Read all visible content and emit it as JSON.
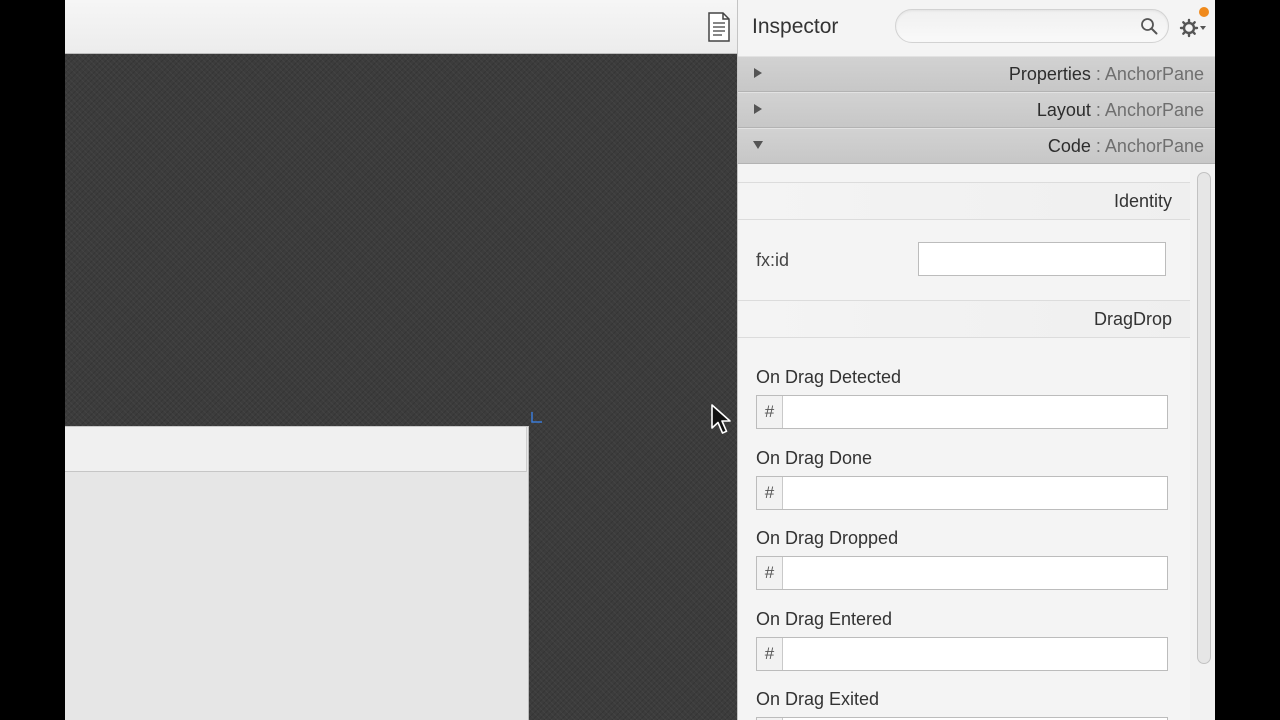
{
  "inspector": {
    "title": "Inspector",
    "search_placeholder": "",
    "search_value": "",
    "settings_icon": "gear-icon",
    "notification_color": "#f08a1c"
  },
  "sections": [
    {
      "name": "Properties",
      "separator": " : ",
      "type": "AnchorPane",
      "state": "collapsed"
    },
    {
      "name": "Layout",
      "separator": " : ",
      "type": "AnchorPane",
      "state": "collapsed"
    },
    {
      "name": "Code",
      "separator": " : ",
      "type": "AnchorPane",
      "state": "expanded"
    }
  ],
  "code": {
    "identity": {
      "header": "Identity",
      "fxid_label": "fx:id",
      "fxid_value": ""
    },
    "dragdrop": {
      "header": "DragDrop",
      "events": [
        {
          "label": "On Drag Detected",
          "prefix": "#",
          "value": ""
        },
        {
          "label": "On Drag Done",
          "prefix": "#",
          "value": ""
        },
        {
          "label": "On Drag Dropped",
          "prefix": "#",
          "value": ""
        },
        {
          "label": "On Drag Entered",
          "prefix": "#",
          "value": ""
        },
        {
          "label": "On Drag Exited",
          "prefix": "#",
          "value": ""
        }
      ]
    }
  },
  "editor": {
    "toolbar_icon": "document-icon",
    "canvas_color": "#3c3c3c",
    "selection_handle_color": "#3b7bd6"
  }
}
